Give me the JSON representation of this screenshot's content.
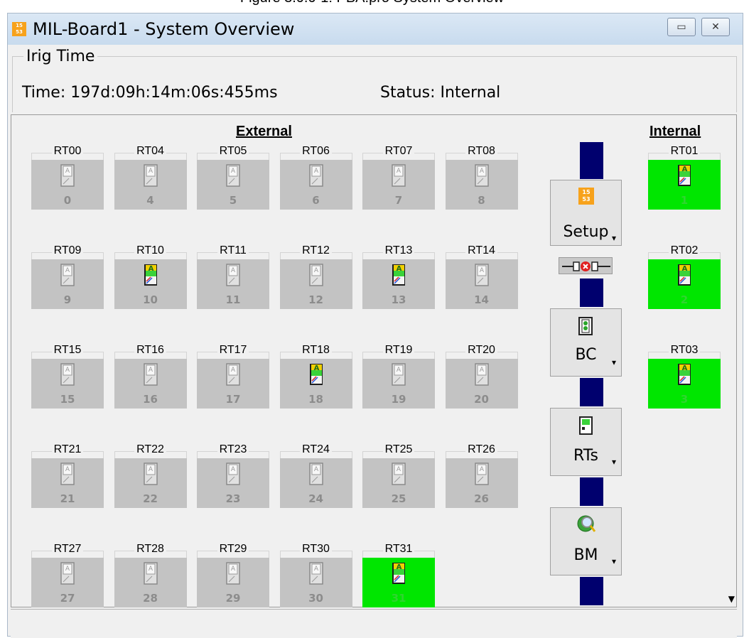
{
  "caption": "Figure 3.0.0-1: PBA.pro System Overview",
  "window": {
    "title": "MIL-Board1 - System Overview",
    "icon": "1553-app-icon",
    "minimize_glyph": "▭",
    "close_glyph": "✕"
  },
  "irig": {
    "legend": "Irig Time",
    "time_label": "Time:  197d:09h:14m:06s:455ms",
    "status_label": "Status:  Internal"
  },
  "external": {
    "title": "External",
    "terminals": [
      {
        "label": "RT00",
        "num": "0",
        "state": "inactive"
      },
      {
        "label": "RT04",
        "num": "4",
        "state": "inactive"
      },
      {
        "label": "RT05",
        "num": "5",
        "state": "inactive"
      },
      {
        "label": "RT06",
        "num": "6",
        "state": "inactive"
      },
      {
        "label": "RT07",
        "num": "7",
        "state": "inactive"
      },
      {
        "label": "RT08",
        "num": "8",
        "state": "inactive"
      },
      {
        "label": "RT09",
        "num": "9",
        "state": "inactive"
      },
      {
        "label": "RT10",
        "num": "10",
        "state": "configured"
      },
      {
        "label": "RT11",
        "num": "11",
        "state": "inactive"
      },
      {
        "label": "RT12",
        "num": "12",
        "state": "inactive"
      },
      {
        "label": "RT13",
        "num": "13",
        "state": "configured"
      },
      {
        "label": "RT14",
        "num": "14",
        "state": "inactive"
      },
      {
        "label": "RT15",
        "num": "15",
        "state": "inactive"
      },
      {
        "label": "RT16",
        "num": "16",
        "state": "inactive"
      },
      {
        "label": "RT17",
        "num": "17",
        "state": "inactive"
      },
      {
        "label": "RT18",
        "num": "18",
        "state": "configured"
      },
      {
        "label": "RT19",
        "num": "19",
        "state": "inactive"
      },
      {
        "label": "RT20",
        "num": "20",
        "state": "inactive"
      },
      {
        "label": "RT21",
        "num": "21",
        "state": "inactive"
      },
      {
        "label": "RT22",
        "num": "22",
        "state": "inactive"
      },
      {
        "label": "RT23",
        "num": "23",
        "state": "inactive"
      },
      {
        "label": "RT24",
        "num": "24",
        "state": "inactive"
      },
      {
        "label": "RT25",
        "num": "25",
        "state": "inactive"
      },
      {
        "label": "RT26",
        "num": "26",
        "state": "inactive"
      },
      {
        "label": "RT27",
        "num": "27",
        "state": "inactive"
      },
      {
        "label": "RT28",
        "num": "28",
        "state": "inactive"
      },
      {
        "label": "RT29",
        "num": "29",
        "state": "inactive"
      },
      {
        "label": "RT30",
        "num": "30",
        "state": "inactive"
      },
      {
        "label": "RT31",
        "num": "31",
        "state": "active"
      }
    ]
  },
  "internal": {
    "title": "Internal",
    "terminals": [
      {
        "label": "RT01",
        "num": "1",
        "state": "active"
      },
      {
        "label": "RT02",
        "num": "2",
        "state": "active"
      },
      {
        "label": "RT03",
        "num": "3",
        "state": "active"
      }
    ]
  },
  "controls": {
    "setup": {
      "label": "Setup",
      "icon": "1553-setup-icon"
    },
    "connector": {
      "icon": "disconnected-plug-icon"
    },
    "bc": {
      "label": "BC",
      "icon": "bus-controller-icon"
    },
    "rts": {
      "label": "RTs",
      "icon": "remote-terminal-icon"
    },
    "bm": {
      "label": "BM",
      "icon": "bus-monitor-icon"
    },
    "dropdown_glyph": "▾"
  },
  "colors": {
    "active": "#00e600",
    "inactive": "#c3c3c3",
    "bus": "#00006e",
    "app_icon": "#f7a21b"
  }
}
